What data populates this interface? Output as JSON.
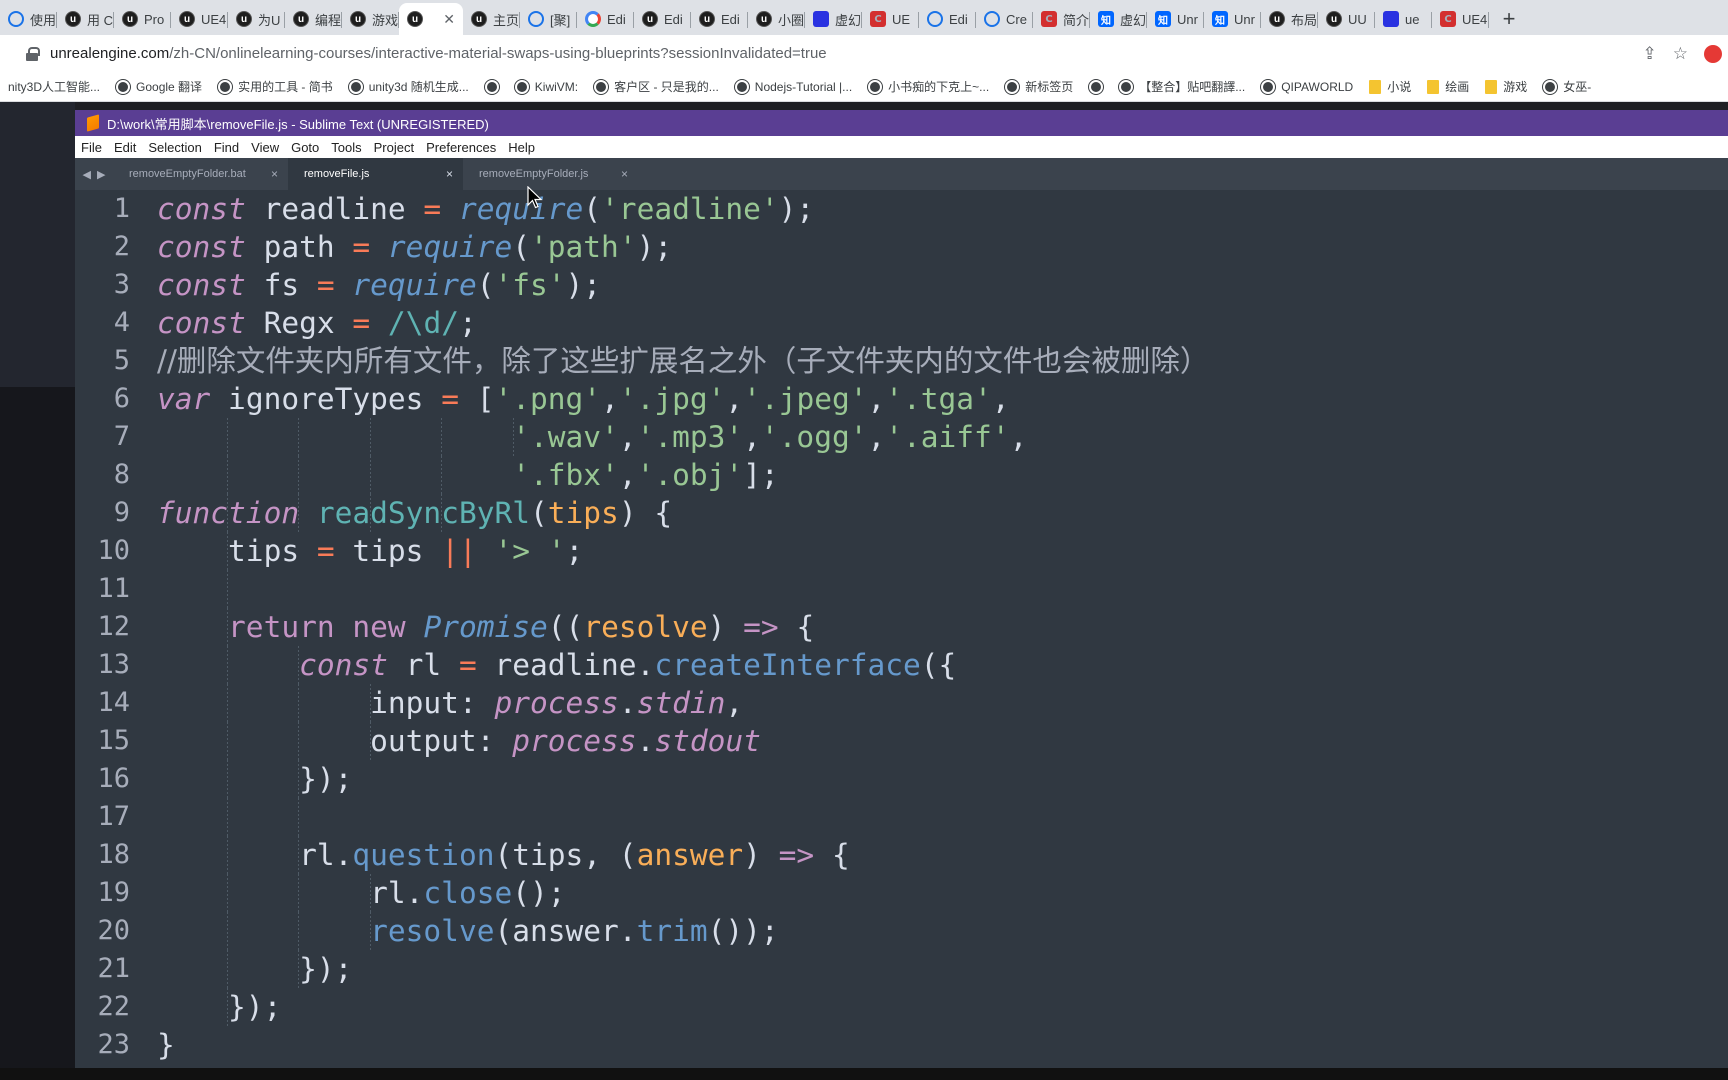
{
  "browser": {
    "tabs": [
      {
        "icon": "web",
        "label": "使用",
        "active": false
      },
      {
        "icon": "ue",
        "label": "用 C",
        "active": false
      },
      {
        "icon": "ue",
        "label": "Pro",
        "active": false
      },
      {
        "icon": "ue",
        "label": "UE4",
        "active": false
      },
      {
        "icon": "ue",
        "label": "为U",
        "active": false
      },
      {
        "icon": "ue",
        "label": "编程",
        "active": false
      },
      {
        "icon": "ue",
        "label": "游戏",
        "active": false
      },
      {
        "icon": "ue",
        "label": "",
        "active": true
      },
      {
        "icon": "ue",
        "label": "主页",
        "active": false
      },
      {
        "icon": "web",
        "label": "[聚]",
        "active": false
      },
      {
        "icon": "g",
        "label": "Edi",
        "active": false
      },
      {
        "icon": "ue",
        "label": "Edi",
        "active": false
      },
      {
        "icon": "ue",
        "label": "Edi",
        "active": false
      },
      {
        "icon": "ue",
        "label": "小圈",
        "active": false
      },
      {
        "icon": "paw",
        "label": "虚幻",
        "active": false
      },
      {
        "icon": "c",
        "label": "UE",
        "active": false
      },
      {
        "icon": "web",
        "label": "Edi",
        "active": false
      },
      {
        "icon": "web",
        "label": "Cre",
        "active": false
      },
      {
        "icon": "c",
        "label": "简介",
        "active": false
      },
      {
        "icon": "zhi",
        "label": "虚幻",
        "active": false
      },
      {
        "icon": "zhi",
        "label": "Unr",
        "active": false
      },
      {
        "icon": "zhi",
        "label": "Unr",
        "active": false
      },
      {
        "icon": "ue",
        "label": "布局",
        "active": false
      },
      {
        "icon": "ue",
        "label": "UU",
        "active": false
      },
      {
        "icon": "paw",
        "label": "ue",
        "active": false
      },
      {
        "icon": "c",
        "label": "UE4",
        "active": false
      }
    ],
    "new_tab": "+",
    "url_host": "unrealengine.com",
    "url_rest": "/zh-CN/onlinelearning-courses/interactive-material-swaps-using-blueprints?sessionInvalidated=true",
    "bookmarks": [
      {
        "label": "nity3D人工智能...",
        "icon": "none"
      },
      {
        "label": "Google 翻译",
        "icon": "globe"
      },
      {
        "label": "实用的工具 - 简书",
        "icon": "globe"
      },
      {
        "label": "unity3d 随机生成...",
        "icon": "globe"
      },
      {
        "label": "",
        "icon": "globe"
      },
      {
        "label": "KiwiVM:",
        "icon": "globe"
      },
      {
        "label": "客户区 - 只是我的...",
        "icon": "globe"
      },
      {
        "label": "Nodejs-Tutorial |...",
        "icon": "globe"
      },
      {
        "label": "小书痴的下克上~...",
        "icon": "globe"
      },
      {
        "label": "新标签页",
        "icon": "globe"
      },
      {
        "label": "",
        "icon": "globe"
      },
      {
        "label": "【整合】贴吧翻譯...",
        "icon": "globe"
      },
      {
        "label": "QIPAWORLD",
        "icon": "globe"
      },
      {
        "label": "小说",
        "icon": "folder"
      },
      {
        "label": "绘画",
        "icon": "folder"
      },
      {
        "label": "游戏",
        "icon": "folder"
      },
      {
        "label": "女巫-",
        "icon": "globe"
      }
    ]
  },
  "sublime": {
    "title": "D:\\work\\常用脚本\\removeFile.js - Sublime Text (UNREGISTERED)",
    "menu": [
      "File",
      "Edit",
      "Selection",
      "Find",
      "View",
      "Goto",
      "Tools",
      "Project",
      "Preferences",
      "Help"
    ],
    "tabs": [
      {
        "label": "removeEmptyFolder.bat",
        "active": false
      },
      {
        "label": "removeFile.js",
        "active": true
      },
      {
        "label": "removeEmptyFolder.js",
        "active": false
      }
    ],
    "close_glyph": "×",
    "arrows": [
      "◀",
      "▶"
    ],
    "lines": [
      {
        "n": "1",
        "indent": 0,
        "tokens": [
          [
            "k",
            "const"
          ],
          [
            "p",
            " readline "
          ],
          [
            "o",
            "="
          ],
          [
            "p",
            " "
          ],
          [
            "f",
            "require"
          ],
          [
            "p",
            "("
          ],
          [
            "s",
            "'readline'"
          ],
          [
            "p",
            ");"
          ]
        ]
      },
      {
        "n": "2",
        "indent": 0,
        "tokens": [
          [
            "k",
            "const"
          ],
          [
            "p",
            " path "
          ],
          [
            "o",
            "="
          ],
          [
            "p",
            " "
          ],
          [
            "f",
            "require"
          ],
          [
            "p",
            "("
          ],
          [
            "s",
            "'path'"
          ],
          [
            "p",
            ");"
          ]
        ]
      },
      {
        "n": "3",
        "indent": 0,
        "tokens": [
          [
            "k",
            "const"
          ],
          [
            "p",
            " fs "
          ],
          [
            "o",
            "="
          ],
          [
            "p",
            " "
          ],
          [
            "f",
            "require"
          ],
          [
            "p",
            "("
          ],
          [
            "s",
            "'fs'"
          ],
          [
            "p",
            ");"
          ]
        ]
      },
      {
        "n": "4",
        "indent": 0,
        "tokens": [
          [
            "k",
            "const"
          ],
          [
            "p",
            " Regx "
          ],
          [
            "o",
            "="
          ],
          [
            "p",
            " "
          ],
          [
            "re",
            "/\\d/"
          ],
          [
            "p",
            ";"
          ]
        ]
      },
      {
        "n": "5",
        "indent": 0,
        "tokens": [
          [
            "c",
            "//删除文件夹内所有文件，除了这些扩展名之外（子文件夹内的文件也会被删除）"
          ]
        ]
      },
      {
        "n": "6",
        "indent": 0,
        "tokens": [
          [
            "k",
            "var"
          ],
          [
            "p",
            " ignoreTypes "
          ],
          [
            "o",
            "="
          ],
          [
            "p",
            " ["
          ],
          [
            "s",
            "'.png'"
          ],
          [
            "p",
            ","
          ],
          [
            "s",
            "'.jpg'"
          ],
          [
            "p",
            ","
          ],
          [
            "s",
            "'.jpeg'"
          ],
          [
            "p",
            ","
          ],
          [
            "s",
            "'.tga'"
          ],
          [
            "p",
            ","
          ]
        ]
      },
      {
        "n": "7",
        "indent": 0,
        "tokens": [
          [
            "p",
            "                    "
          ],
          [
            "s",
            "'.wav'"
          ],
          [
            "p",
            ","
          ],
          [
            "s",
            "'.mp3'"
          ],
          [
            "p",
            ","
          ],
          [
            "s",
            "'.ogg'"
          ],
          [
            "p",
            ","
          ],
          [
            "s",
            "'.aiff'"
          ],
          [
            "p",
            ","
          ]
        ]
      },
      {
        "n": "8",
        "indent": 0,
        "tokens": [
          [
            "p",
            "                    "
          ],
          [
            "s",
            "'.fbx'"
          ],
          [
            "p",
            ","
          ],
          [
            "s",
            "'.obj'"
          ],
          [
            "p",
            "];"
          ]
        ]
      },
      {
        "n": "9",
        "indent": 0,
        "tokens": [
          [
            "k",
            "function"
          ],
          [
            "p",
            " "
          ],
          [
            "fd",
            "readSyncByRl"
          ],
          [
            "p",
            "("
          ],
          [
            "pa",
            "tips"
          ],
          [
            "p",
            ") {"
          ]
        ]
      },
      {
        "n": "10",
        "indent": 0,
        "tokens": [
          [
            "p",
            "    tips "
          ],
          [
            "o",
            "="
          ],
          [
            "p",
            " tips "
          ],
          [
            "o",
            "||"
          ],
          [
            "p",
            " "
          ],
          [
            "s",
            "'> '"
          ],
          [
            "p",
            ";"
          ]
        ]
      },
      {
        "n": "11",
        "indent": 0,
        "tokens": []
      },
      {
        "n": "12",
        "indent": 0,
        "tokens": [
          [
            "p",
            "    "
          ],
          [
            "kw",
            "return"
          ],
          [
            "p",
            " "
          ],
          [
            "kw",
            "new"
          ],
          [
            "p",
            " "
          ],
          [
            "f",
            "Promise"
          ],
          [
            "p",
            "(("
          ],
          [
            "pa",
            "resolve"
          ],
          [
            "p",
            ") "
          ],
          [
            "kw",
            "=>"
          ],
          [
            "p",
            " {"
          ]
        ]
      },
      {
        "n": "13",
        "indent": 0,
        "tokens": [
          [
            "p",
            "        "
          ],
          [
            "k",
            "const"
          ],
          [
            "p",
            " rl "
          ],
          [
            "o",
            "="
          ],
          [
            "p",
            " readline"
          ],
          [
            "p",
            "."
          ],
          [
            "fn",
            "createInterface"
          ],
          [
            "p",
            "({"
          ]
        ]
      },
      {
        "n": "14",
        "indent": 0,
        "tokens": [
          [
            "p",
            "            input"
          ],
          [
            "p",
            ": "
          ],
          [
            "iv",
            "process"
          ],
          [
            "p",
            "."
          ],
          [
            "iv",
            "stdin"
          ],
          [
            "p",
            ","
          ]
        ]
      },
      {
        "n": "15",
        "indent": 0,
        "tokens": [
          [
            "p",
            "            output"
          ],
          [
            "p",
            ": "
          ],
          [
            "iv",
            "process"
          ],
          [
            "p",
            "."
          ],
          [
            "iv",
            "stdout"
          ]
        ]
      },
      {
        "n": "16",
        "indent": 0,
        "tokens": [
          [
            "p",
            "        });"
          ]
        ]
      },
      {
        "n": "17",
        "indent": 0,
        "tokens": []
      },
      {
        "n": "18",
        "indent": 0,
        "tokens": [
          [
            "p",
            "        rl."
          ],
          [
            "fn",
            "question"
          ],
          [
            "p",
            "(tips, ("
          ],
          [
            "pa",
            "answer"
          ],
          [
            "p",
            ") "
          ],
          [
            "kw",
            "=>"
          ],
          [
            "p",
            " {"
          ]
        ]
      },
      {
        "n": "19",
        "indent": 0,
        "tokens": [
          [
            "p",
            "            rl."
          ],
          [
            "fn",
            "close"
          ],
          [
            "p",
            "();"
          ]
        ]
      },
      {
        "n": "20",
        "indent": 0,
        "tokens": [
          [
            "p",
            "            "
          ],
          [
            "fn",
            "resolve"
          ],
          [
            "p",
            "(answer."
          ],
          [
            "fn",
            "trim"
          ],
          [
            "p",
            "());"
          ]
        ]
      },
      {
        "n": "21",
        "indent": 0,
        "tokens": [
          [
            "p",
            "        });"
          ]
        ]
      },
      {
        "n": "22",
        "indent": 0,
        "tokens": [
          [
            "p",
            "    });"
          ]
        ]
      },
      {
        "n": "23",
        "indent": 0,
        "tokens": [
          [
            "p",
            "}"
          ]
        ]
      }
    ]
  },
  "colors": {
    "title_bar": "#5a3e93",
    "editor_bg": "#303841",
    "keyword": "#c594c5",
    "string": "#99c794",
    "function": "#6699cc",
    "operator": "#f97b58"
  }
}
